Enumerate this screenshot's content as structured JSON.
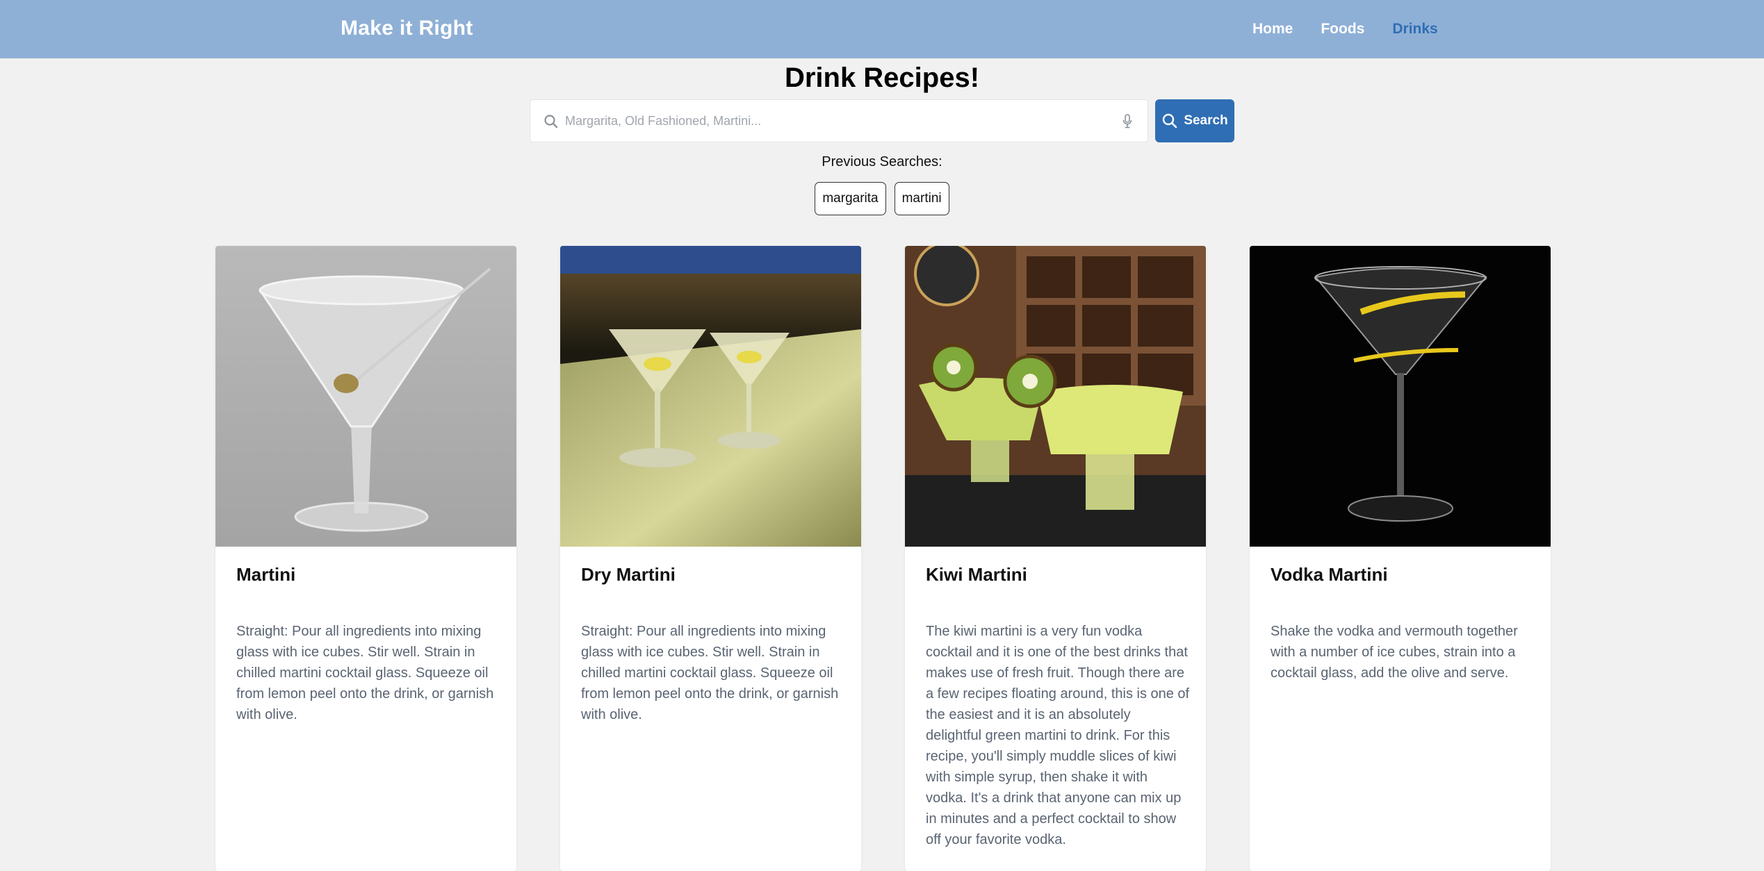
{
  "navbar": {
    "brand": "Make it Right",
    "links": [
      {
        "label": "Home",
        "active": false
      },
      {
        "label": "Foods",
        "active": false
      },
      {
        "label": "Drinks",
        "active": true
      }
    ],
    "background_color": "#8fb0d6",
    "active_color": "#2f6eb4"
  },
  "page": {
    "title": "Drink Recipes!"
  },
  "search": {
    "placeholder": "Margarita, Old Fashioned, Martini...",
    "value": "",
    "button_label": "Search",
    "search_icon": "search-icon",
    "mic_icon": "microphone-icon"
  },
  "previous_searches": {
    "label": "Previous Searches:",
    "items": [
      "margarita",
      "martini"
    ]
  },
  "recipes": [
    {
      "name": "Martini",
      "description": "Straight: Pour all ingredients into mixing glass with ice cubes. Stir well. Strain in chilled martini cocktail glass. Squeeze oil from lemon peel onto the drink, or garnish with olive."
    },
    {
      "name": "Dry Martini",
      "description": "Straight: Pour all ingredients into mixing glass with ice cubes. Stir well. Strain in chilled martini cocktail glass. Squeeze oil from lemon peel onto the drink, or garnish with olive."
    },
    {
      "name": "Kiwi Martini",
      "description": "The kiwi martini is a very fun vodka cocktail and it is one of the best drinks that makes use of fresh fruit. Though there are a few recipes floating around, this is one of the easiest and it is an absolutely delightful green martini to drink. For this recipe, you'll simply muddle slices of kiwi with simple syrup, then shake it with vodka. It's a drink that anyone can mix up in minutes and a perfect cocktail to show off your favorite vodka."
    },
    {
      "name": "Vodka Martini",
      "description": "Shake the vodka and vermouth together with a number of ice cubes, strain into a cocktail glass, add the olive and serve."
    }
  ]
}
